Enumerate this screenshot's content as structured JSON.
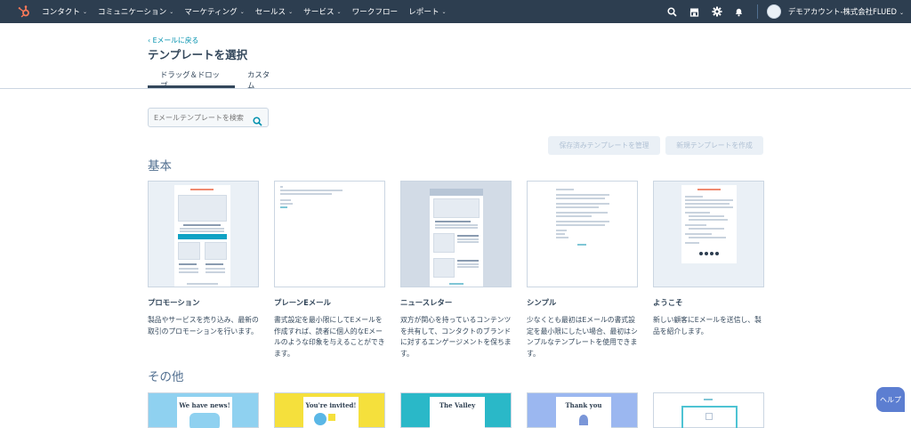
{
  "nav": {
    "items": [
      {
        "label": "コンタクト"
      },
      {
        "label": "コミュニケーション"
      },
      {
        "label": "マーケティング"
      },
      {
        "label": "セールス"
      },
      {
        "label": "サービス"
      },
      {
        "label": "ワークフロー"
      },
      {
        "label": "レポート"
      }
    ],
    "account": "デモアカウント-株式会社FLUED",
    "icons": [
      "search-icon",
      "marketplace-icon",
      "settings-icon",
      "notifications-icon"
    ]
  },
  "header": {
    "back_link": "‹ Eメールに戻る",
    "title": "テンプレートを選択"
  },
  "tabs": [
    {
      "label": "ドラッグ＆ドロップ",
      "active": true
    },
    {
      "label": "カスタム",
      "active": false
    }
  ],
  "search": {
    "placeholder": "Eメールテンプレートを検索"
  },
  "buttons": {
    "manage": "保存済みテンプレートを管理",
    "create": "新規テンプレートを作成"
  },
  "sections": {
    "basic": "基本",
    "other": "その他"
  },
  "templates": [
    {
      "title": "プロモーション",
      "description": "製品やサービスを売り込み、最新の取引のプロモーションを行います。"
    },
    {
      "title": "プレーンEメール",
      "description": "書式設定を最小限にしてEメールを作成すれば、読者に個人的なEメールのような印象を与えることができます。"
    },
    {
      "title": "ニュースレター",
      "description": "双方が関心を持っているコンテンツを共有して、コンタクトのブランドに対するエンゲージメントを保ちます。"
    },
    {
      "title": "シンプル",
      "description": "少なくとも最初はEメールの書式設定を最小限にしたい場合、最初はシンプルなテンプレートを使用できます。"
    },
    {
      "title": "ようこそ",
      "description": "新しい顧客にEメールを送信し、製品を紹介します。"
    }
  ],
  "other_templates": [
    {
      "label": "We have news!",
      "bg": "#8fd1f0"
    },
    {
      "label": "You're invited!",
      "bg": "#f5e03c"
    },
    {
      "label": "The Valley",
      "bg": "#2ab8c8"
    },
    {
      "label": "Thank you",
      "bg": "#9bb7f0"
    },
    {
      "label": "",
      "bg": "#ffffff"
    }
  ],
  "help": "ヘルプ",
  "colors": {
    "nav_bg": "#2d3e50",
    "accent": "#ff7a59",
    "link": "#0091ae",
    "teal": "#00a4bd"
  }
}
